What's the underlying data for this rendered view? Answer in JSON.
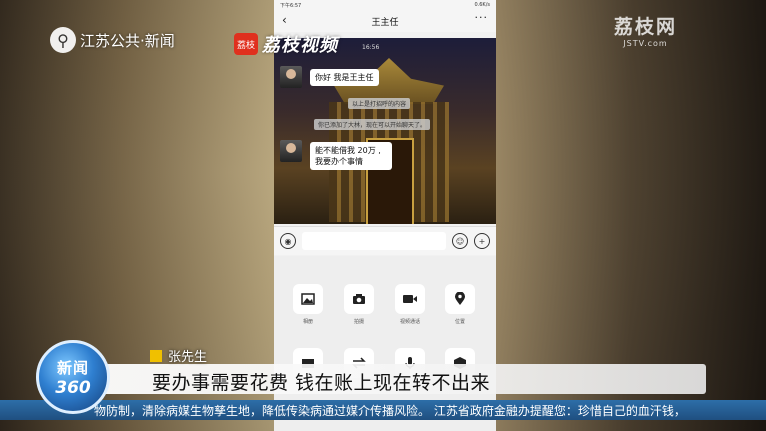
{
  "phone": {
    "status_left": "下午6:57",
    "status_right": "0.6K/s",
    "chat_title": "王主任",
    "timestamp": "16:56",
    "messages": [
      {
        "text": "你好 我是王主任"
      },
      {
        "text": "以上是打招呼的内容",
        "system": true
      },
      {
        "text": "你已添加了大林，现在可以开始聊天了。",
        "system": true
      },
      {
        "text": "能不能借我 20万 ,我要办个事情"
      }
    ],
    "tools": [
      {
        "label": "相册",
        "icon": "image-icon"
      },
      {
        "label": "拍摄",
        "icon": "camera-icon"
      },
      {
        "label": "视频通话",
        "icon": "video-icon"
      },
      {
        "label": "位置",
        "icon": "location-icon"
      }
    ]
  },
  "overlay": {
    "channel_logo": "江苏公共·新闻",
    "lizhi_mark": "荔枝",
    "lizhi_text": "荔枝视频",
    "tr_logo_big": "荔枝网",
    "tr_logo_small": "JSTV.com",
    "news_logo_top": "新闻",
    "news_logo_bottom": "360",
    "speaker": "张先生",
    "subtitle": "要办事需要花费 钱在账上现在转不出来",
    "ticker": "物防制，清除病媒生物孳生地，降低传染病通过媒介传播风险。  江苏省政府金融办提醒您：珍惜自己的血汗钱，"
  },
  "colors": {
    "ticker_bg": "#2a62a0",
    "name_square": "#f0c000",
    "lizhi_red": "#e0301e"
  }
}
